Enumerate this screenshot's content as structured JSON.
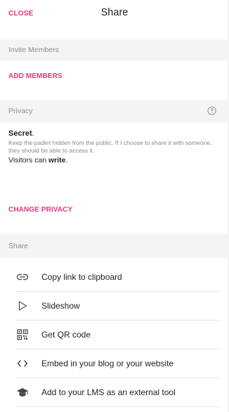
{
  "header": {
    "close_label": "CLOSE",
    "title": "Share"
  },
  "invite": {
    "section_label": "Invite Members",
    "add_members_label": "ADD MEMBERS"
  },
  "privacy": {
    "section_label": "Privacy",
    "help_icon": "question-circle-icon",
    "secret_title": "Secret",
    "secret_period": ".",
    "secret_description": "Keep the padlet hidden from the public. If I choose to share it with someone, they should be able to access it.",
    "visitors_prefix": "Visitors can ",
    "visitors_permission": "write",
    "visitors_suffix": ".",
    "change_privacy_label": "CHANGE PRIVACY"
  },
  "share": {
    "section_label": "Share",
    "items": [
      {
        "label": "Copy link to clipboard",
        "icon": "link-icon"
      },
      {
        "label": "Slideshow",
        "icon": "play-icon"
      },
      {
        "label": "Get QR code",
        "icon": "qr-code-icon"
      },
      {
        "label": "Embed in your blog or your website",
        "icon": "code-icon"
      },
      {
        "label": "Add to your LMS as an external tool",
        "icon": "graduation-cap-icon"
      }
    ]
  },
  "colors": {
    "accent": "#e8357a",
    "section_bg": "#f4f4f4",
    "muted_text": "#8c8c8c"
  }
}
